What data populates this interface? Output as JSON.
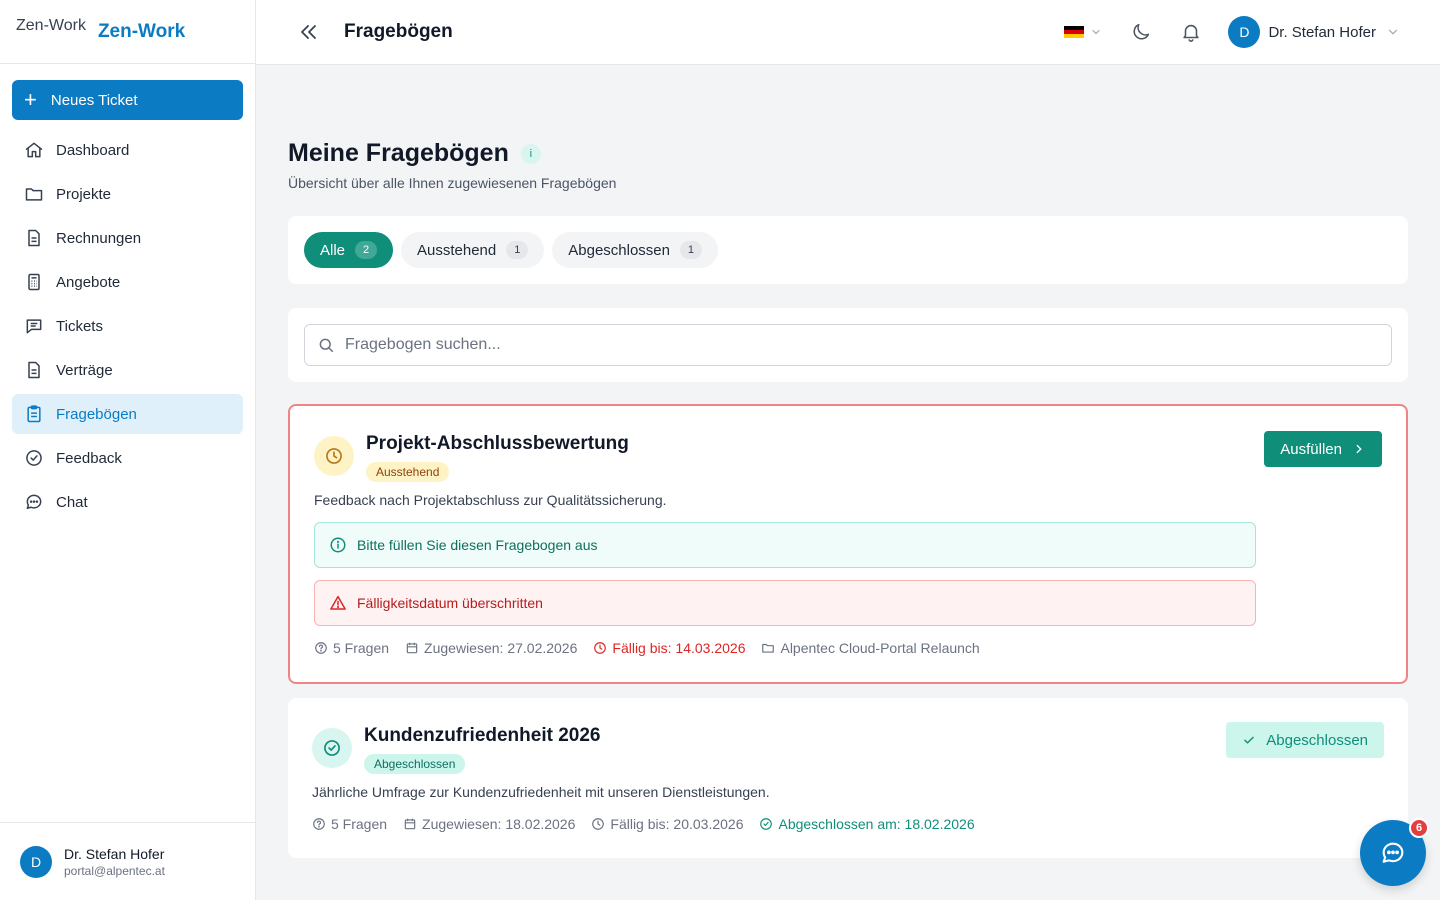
{
  "brand": {
    "logo_alt": "Zen-Work",
    "name": "Zen-Work"
  },
  "sidebar": {
    "new_ticket": "Neues Ticket",
    "items": [
      {
        "label": "Dashboard",
        "icon": "home-icon"
      },
      {
        "label": "Projekte",
        "icon": "folder-icon"
      },
      {
        "label": "Rechnungen",
        "icon": "document-icon"
      },
      {
        "label": "Angebote",
        "icon": "calculator-icon"
      },
      {
        "label": "Tickets",
        "icon": "message-square-icon"
      },
      {
        "label": "Verträge",
        "icon": "document-icon"
      },
      {
        "label": "Fragebögen",
        "icon": "clipboard-icon",
        "active": true
      },
      {
        "label": "Feedback",
        "icon": "check-circle-icon"
      },
      {
        "label": "Chat",
        "icon": "chat-bubble-icon"
      }
    ],
    "user": {
      "initial": "D",
      "name": "Dr. Stefan Hofer",
      "email": "portal@alpentec.at"
    }
  },
  "header": {
    "title": "Fragebögen",
    "user": {
      "initial": "D",
      "name": "Dr. Stefan Hofer"
    }
  },
  "page": {
    "title": "Meine Fragebögen",
    "info": "i",
    "subtitle": "Übersicht über alle Ihnen zugewiesenen Fragebögen"
  },
  "filters": [
    {
      "label": "Alle",
      "count": "2",
      "active": true
    },
    {
      "label": "Ausstehend",
      "count": "1"
    },
    {
      "label": "Abgeschlossen",
      "count": "1"
    }
  ],
  "search": {
    "placeholder": "Fragebogen suchen..."
  },
  "questionnaires": [
    {
      "title": "Projekt-Abschlussbewertung",
      "status": "Ausstehend",
      "description": "Feedback nach Projektabschluss zur Qualitätssicherung.",
      "info_notice": "Bitte füllen Sie diesen Fragebogen aus",
      "warning_notice": "Fälligkeitsdatum überschritten",
      "questions": "5 Fragen",
      "assigned": "Zugewiesen: 27.02.2026",
      "due": "Fällig bis: 14.03.2026",
      "project": "Alpentec Cloud-Portal Relaunch",
      "action": "Ausfüllen"
    },
    {
      "title": "Kundenzufriedenheit 2026",
      "status": "Abgeschlossen",
      "description": "Jährliche Umfrage zur Kundenzufriedenheit mit unseren Dienstleistungen.",
      "questions": "5 Fragen",
      "assigned": "Zugewiesen: 18.02.2026",
      "due": "Fällig bis: 20.03.2026",
      "completed": "Abgeschlossen am: 18.02.2026",
      "action": "Abgeschlossen"
    }
  ],
  "chat": {
    "unread": "6"
  },
  "colors": {
    "primary": "#0b7bc4",
    "teal": "#0f8f7a",
    "danger": "#dc2626",
    "warning_bg": "#fef2f2",
    "info_bg": "#effcf9"
  }
}
